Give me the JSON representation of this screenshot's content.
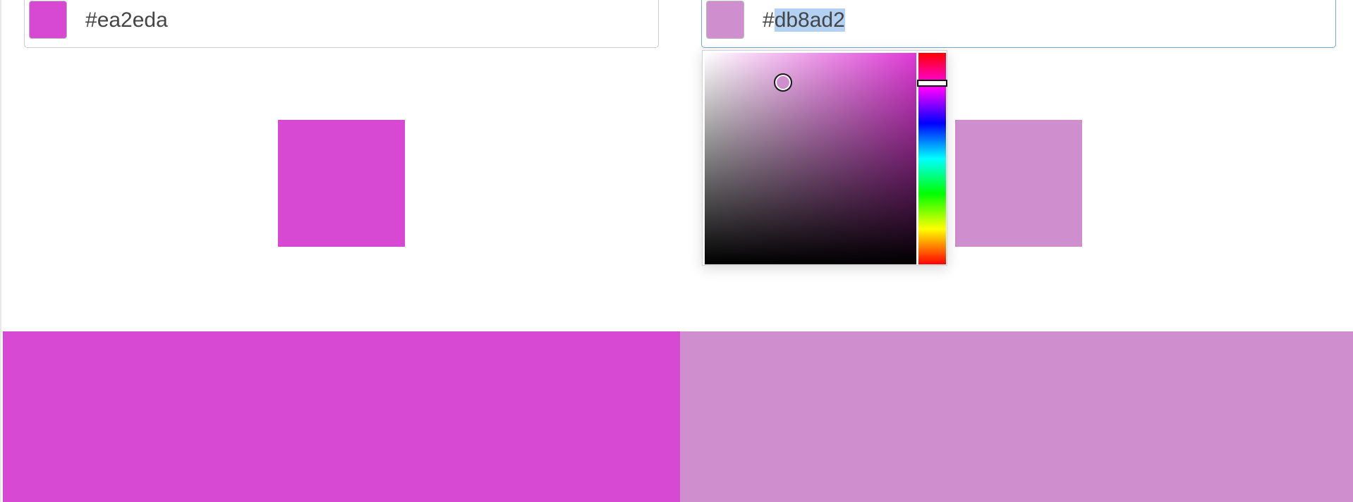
{
  "left_picker": {
    "hex_prefix": "#",
    "hex_value": "ea2eda",
    "color": "#d749d3"
  },
  "right_picker": {
    "hex_prefix": "#",
    "hex_selected": "db8ad2",
    "color": "#cf8ecd"
  },
  "popup": {
    "hue_color": "#e03ad8",
    "saturation": 0.37,
    "value": 0.86,
    "hue_level": 0.14
  }
}
